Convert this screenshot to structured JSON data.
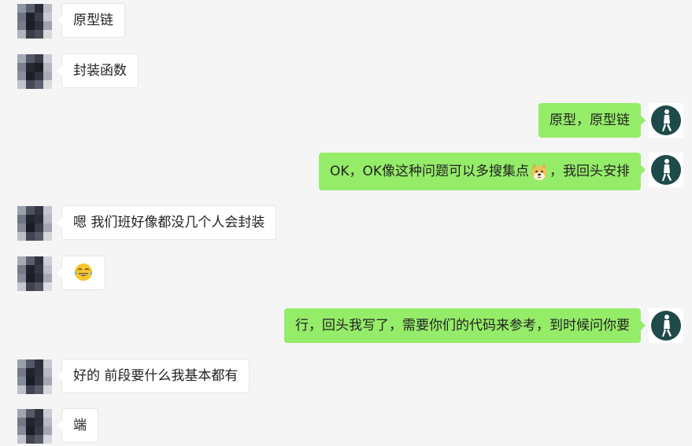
{
  "colors": {
    "background": "#f5f5f5",
    "incoming_bubble": "#ffffff",
    "outgoing_bubble": "#95ec69",
    "text": "#222222"
  },
  "messages": [
    {
      "side": "in",
      "text": "原型链"
    },
    {
      "side": "in",
      "text": "封装函数"
    },
    {
      "side": "out",
      "text": "原型，原型链"
    },
    {
      "side": "out",
      "text_before": "OK，OK像这种问题可以多搜集点",
      "emoji": "doge-emoji",
      "text_after": "，我回头安排"
    },
    {
      "side": "in",
      "text": "嗯 我们班好像都没几个人会封装"
    },
    {
      "side": "in",
      "emoji": "tears-of-joy-emoji"
    },
    {
      "side": "out",
      "text": "行，回头我写了，需要你们的代码来参考，到时候问你要"
    },
    {
      "side": "in",
      "text": "好的 前段要什么我基本都有"
    },
    {
      "side": "in",
      "text": "端"
    }
  ]
}
